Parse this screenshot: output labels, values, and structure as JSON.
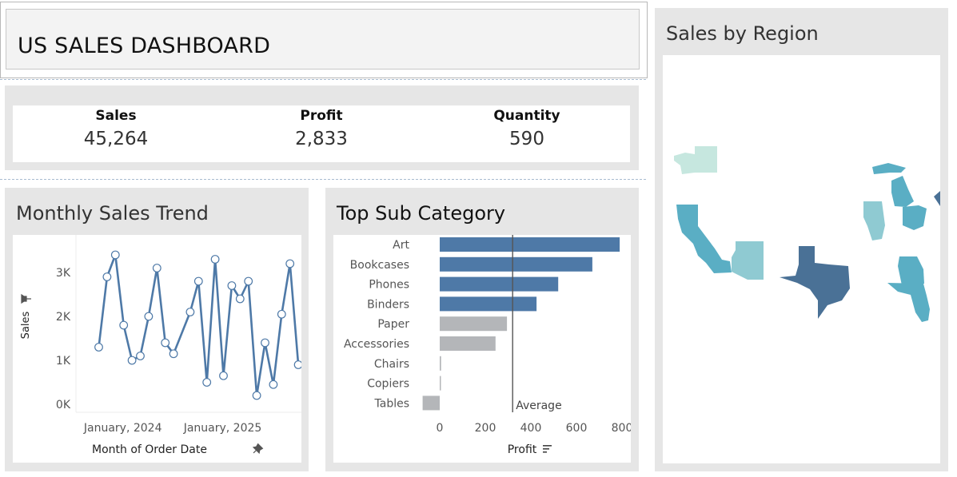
{
  "dashboard": {
    "title": "US SALES DASHBOARD"
  },
  "kpis": [
    {
      "label": "Sales",
      "value": "45,264"
    },
    {
      "label": "Profit",
      "value": "2,833"
    },
    {
      "label": "Quantity",
      "value": "590"
    }
  ],
  "monthly_trend": {
    "title": "Monthly Sales Trend",
    "y_axis_label": "Sales",
    "x_axis_label": "Month of Order Date",
    "pin_icon": "pin-icon"
  },
  "top_sub_category": {
    "title": "Top Sub Category",
    "x_axis_label": "Profit",
    "reference_line_label": "Average",
    "sort_icon": "sort-icon"
  },
  "sales_by_region": {
    "title": "Sales by Region",
    "states": [
      "Washington",
      "California",
      "Arizona",
      "Texas",
      "Illinois",
      "Michigan",
      "Ohio",
      "Georgia",
      "Florida"
    ]
  },
  "colors": {
    "accent": "#4e79a7",
    "bar_positive": "#4e79a7",
    "bar_neutral": "#b4b6b9",
    "map_light": "#c6e7df",
    "map_mid": "#8fcad2",
    "map_teal": "#5aaec4",
    "map_dark": "#4a7196"
  },
  "chart_data": [
    {
      "type": "line",
      "title": "Monthly Sales Trend",
      "xlabel": "Month of Order Date",
      "ylabel": "Sales",
      "x_tick_labels": [
        "January, 2024",
        "January, 2025"
      ],
      "y_tick_labels": [
        "0K",
        "1K",
        "2K",
        "3K"
      ],
      "ylim": [
        0,
        3600
      ],
      "x": [
        "2023-10",
        "2023-11",
        "2023-12",
        "2024-01",
        "2024-02",
        "2024-03",
        "2024-04",
        "2024-05",
        "2024-06",
        "2024-07",
        "2024-08",
        "2024-09",
        "2024-10",
        "2024-11",
        "2024-12",
        "2025-01",
        "2025-02",
        "2025-03",
        "2025-04",
        "2025-05",
        "2025-06",
        "2025-07",
        "2025-08",
        "2025-09",
        "2025-10",
        "2025-11",
        "2025-12"
      ],
      "values": [
        1300,
        2900,
        3400,
        1800,
        1000,
        1100,
        2000,
        3100,
        1400,
        1150,
        null,
        2100,
        2800,
        500,
        3300,
        650,
        2700,
        2400,
        2800,
        200,
        1400,
        450,
        2050,
        3200,
        900
      ],
      "grid": false
    },
    {
      "type": "bar",
      "orientation": "horizontal",
      "title": "Top Sub Category",
      "xlabel": "Profit",
      "categories": [
        "Art",
        "Bookcases",
        "Phones",
        "Binders",
        "Paper",
        "Accessories",
        "Chairs",
        "Copiers",
        "Tables"
      ],
      "values": [
        790,
        670,
        520,
        425,
        295,
        245,
        6,
        3,
        -75
      ],
      "highlight": [
        true,
        true,
        true,
        true,
        false,
        false,
        false,
        false,
        false
      ],
      "xlim": [
        -80,
        830
      ],
      "x_tick_labels": [
        "0",
        "200",
        "400",
        "600",
        "800"
      ],
      "reference_line": {
        "label": "Average",
        "value": 320
      }
    }
  ]
}
